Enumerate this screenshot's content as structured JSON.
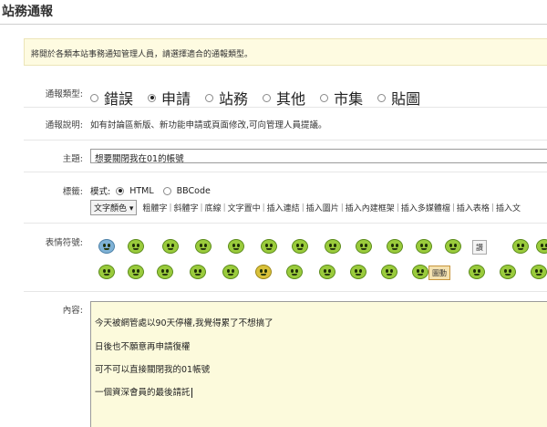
{
  "page": {
    "title": "站務通報",
    "notice": "將開於各類本站事務通知管理人員，請選擇適合的通報類型。"
  },
  "type_row": {
    "label": "通報類型:",
    "options": [
      {
        "label": "錯誤",
        "selected": false
      },
      {
        "label": "申請",
        "selected": true
      },
      {
        "label": "站務",
        "selected": false
      },
      {
        "label": "其他",
        "selected": false
      },
      {
        "label": "市集",
        "selected": false
      },
      {
        "label": "貼圖",
        "selected": false
      }
    ]
  },
  "desc_row": {
    "label": "通報說明:",
    "text": "如有討論區新版、新功能申請或頁面修改,可向管理人員提議。"
  },
  "subject_row": {
    "label": "主題:",
    "value": "想要關閉我在01的帳號"
  },
  "tags_row": {
    "label": "標籤:",
    "mode_label": "模式:",
    "mode_html": "HTML",
    "mode_bbcode": "BBCode",
    "mode_selected": "HTML",
    "font_color_select": "文字顏色",
    "toolbar": [
      "粗體字",
      "斜體字",
      "底線",
      "文字置中",
      "插入連結",
      "插入圖片",
      "插入內建框架",
      "插入多媒體檔",
      "插入表格",
      "插入文"
    ]
  },
  "smiley_row": {
    "label": "表情符號:",
    "tag_text_1": "讚",
    "tag_text_2": "圖動"
  },
  "content_row": {
    "label": "內容:",
    "lines": [
      "今天被網管處以90天停權,我覺得累了不想搞了",
      "日後也不願意再申請復權",
      "可不可以直接關閉我的01帳號",
      "一個資深會員的最後請託"
    ]
  },
  "colors": {
    "notice_bg": "#fefbe1",
    "editor_bg": "#fcfadc",
    "smiley_green": "#9acb3c"
  }
}
